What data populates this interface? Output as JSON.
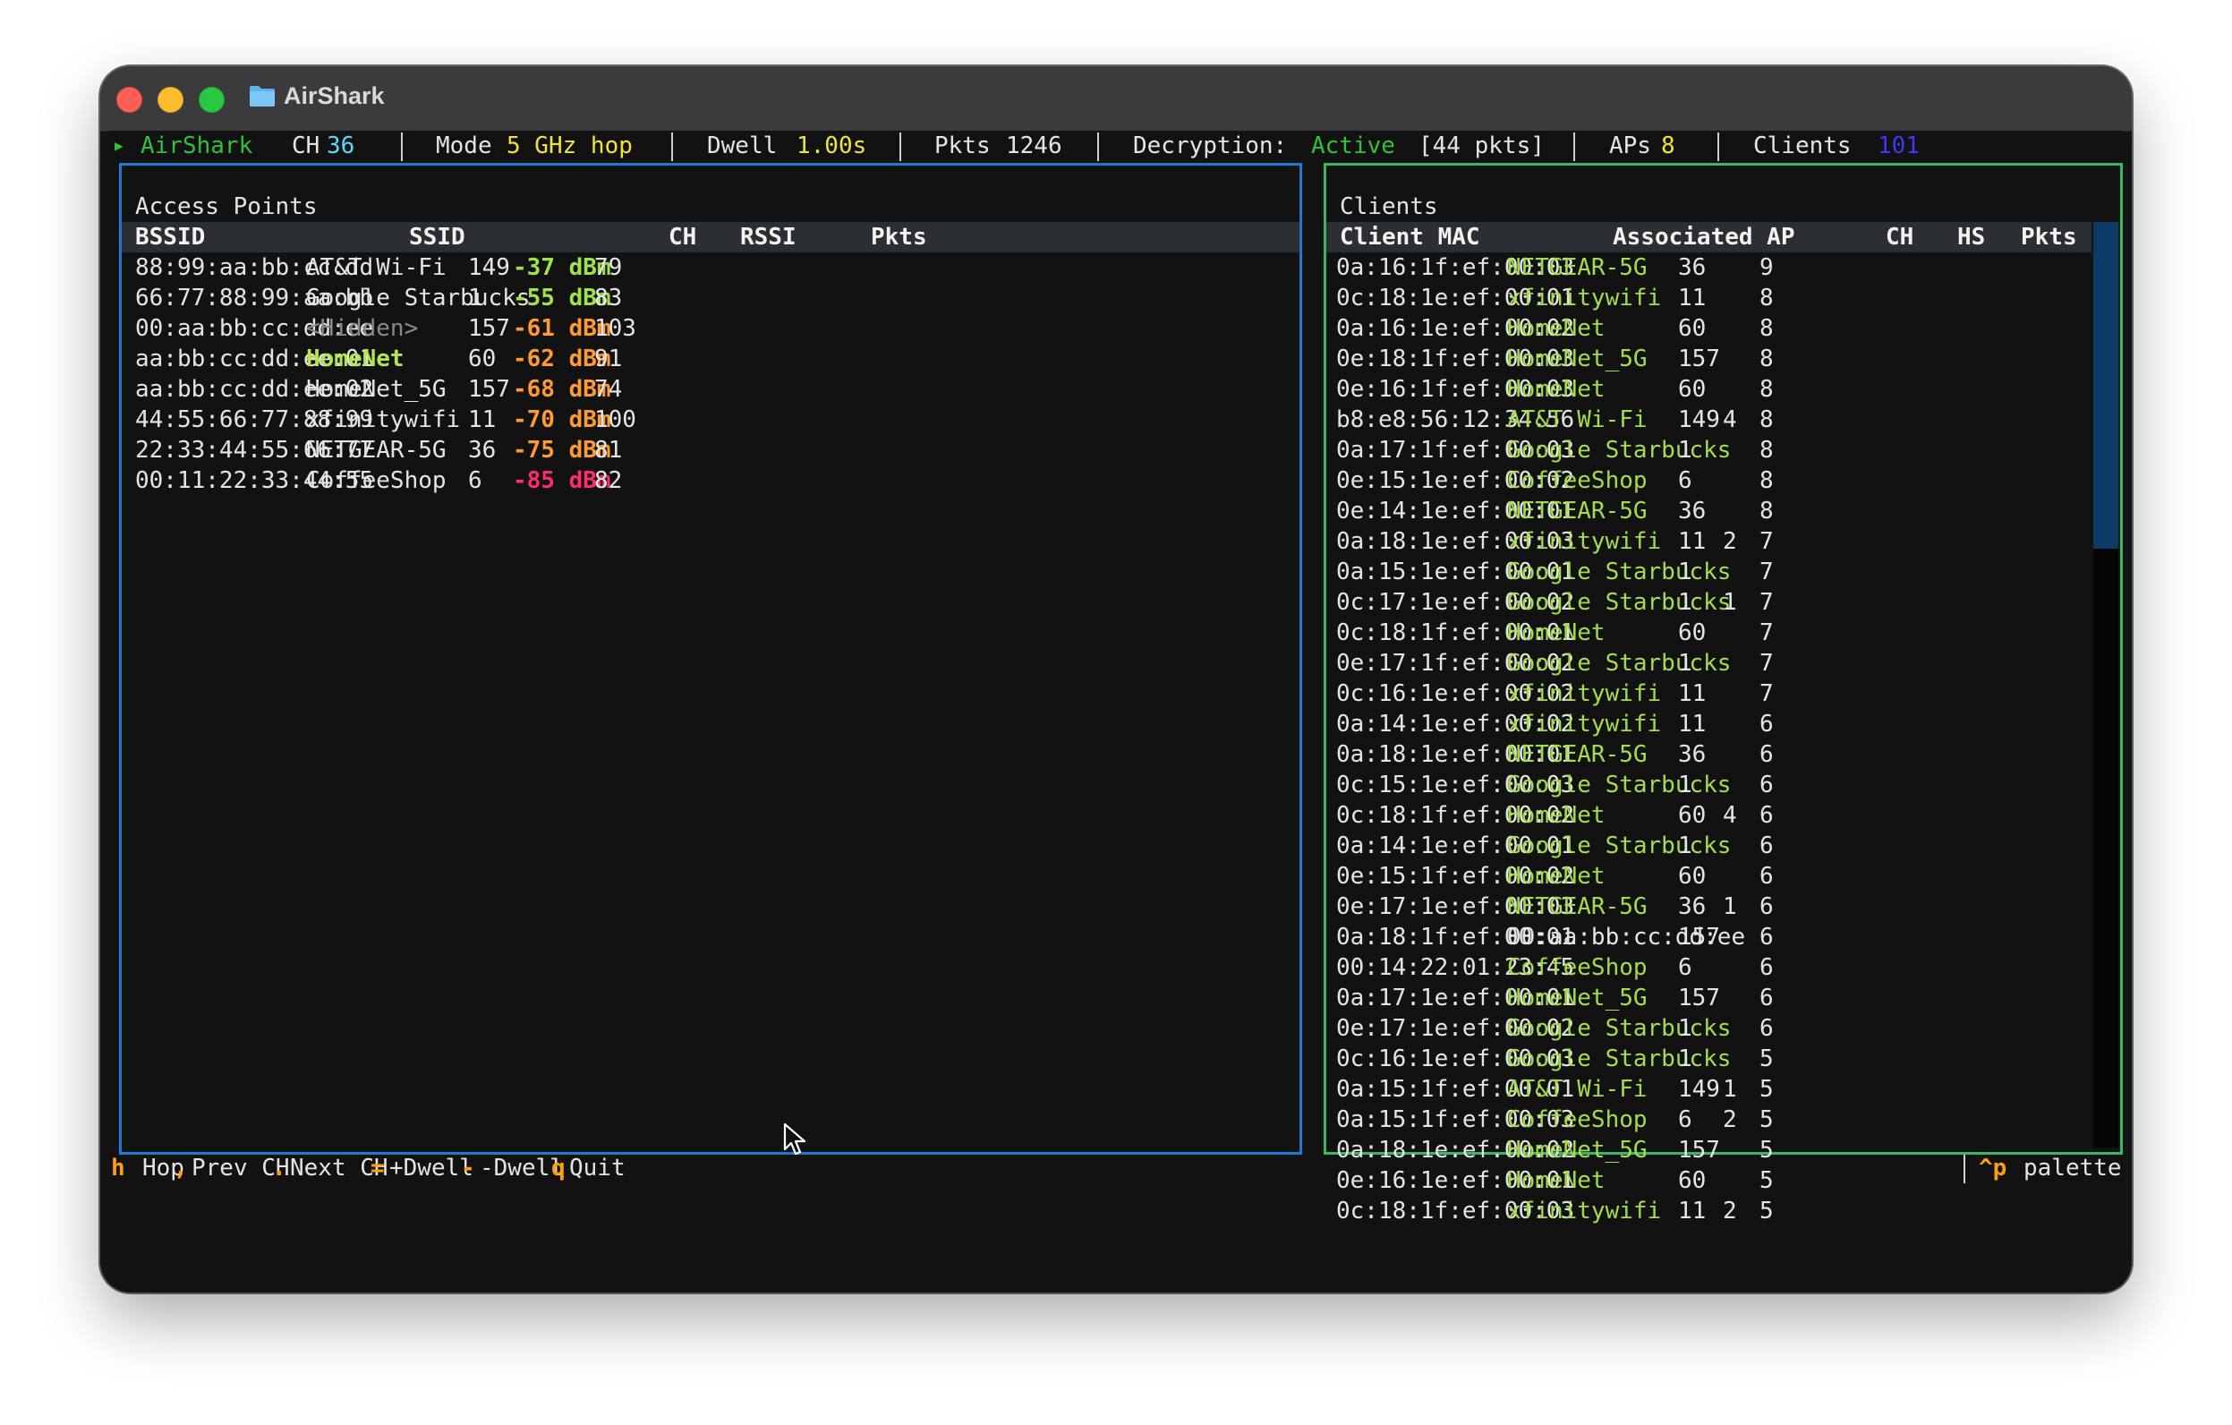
{
  "window": {
    "title": "AirShark",
    "icon": "folder-icon"
  },
  "statusbar": {
    "app_name": "AirShark",
    "ch_label": "CH",
    "ch_value": "36",
    "mode_label": "Mode",
    "mode_value": "5 GHz hop",
    "dwell_label": "Dwell",
    "dwell_value": "1.00s",
    "pkts_label": "Pkts",
    "pkts_value": "1246",
    "decryption_label": "Decryption:",
    "decryption_status": "Active",
    "decryption_detail": "[44 pkts]",
    "aps_label": "APs",
    "aps_value": "8",
    "clients_label": "Clients",
    "clients_value": "101"
  },
  "colors": {
    "ap_panel_border": "#1f78d6",
    "clients_panel_border": "#3bb764",
    "rssi_strong": "#9ee34a",
    "rssi_medium": "#ff9b2f",
    "rssi_weak": "#ff2b6a",
    "key_hint": "#ff9f0a"
  },
  "access_points": {
    "title": "Access Points",
    "columns": [
      "BSSID",
      "SSID",
      "CH",
      "RSSI",
      "Pkts"
    ],
    "rows": [
      {
        "bssid": "88:99:aa:bb:cc:dd",
        "ssid": "AT&T Wi-Fi",
        "ssid_style": "normal",
        "ch": "149",
        "rssi": "-37 dBm",
        "rssi_level": "strong",
        "pkts": "79"
      },
      {
        "bssid": "66:77:88:99:aa:bb",
        "ssid": "Google Starbucks",
        "ssid_style": "normal",
        "ch": "1",
        "rssi": "-55 dBm",
        "rssi_level": "strong",
        "pkts": "83"
      },
      {
        "bssid": "00:aa:bb:cc:dd:ee",
        "ssid": "<Hidden>",
        "ssid_style": "hidden",
        "ch": "157",
        "rssi": "-61 dBm",
        "rssi_level": "medium",
        "pkts": "103"
      },
      {
        "bssid": "aa:bb:cc:dd:ee:01",
        "ssid": "HomeNet",
        "ssid_style": "bold",
        "ch": "60",
        "rssi": "-62 dBm",
        "rssi_level": "medium",
        "pkts": "91"
      },
      {
        "bssid": "aa:bb:cc:dd:ee:02",
        "ssid": "HomeNet_5G",
        "ssid_style": "normal",
        "ch": "157",
        "rssi": "-68 dBm",
        "rssi_level": "medium",
        "pkts": "74"
      },
      {
        "bssid": "44:55:66:77:88:99",
        "ssid": "xfinitywifi",
        "ssid_style": "normal",
        "ch": "11",
        "rssi": "-70 dBm",
        "rssi_level": "medium",
        "pkts": "100"
      },
      {
        "bssid": "22:33:44:55:66:77",
        "ssid": "NETGEAR-5G",
        "ssid_style": "normal",
        "ch": "36",
        "rssi": "-75 dBm",
        "rssi_level": "medium",
        "pkts": "81"
      },
      {
        "bssid": "00:11:22:33:44:55",
        "ssid": "CoffeeShop",
        "ssid_style": "normal",
        "ch": "6",
        "rssi": "-85 dBm",
        "rssi_level": "weak",
        "pkts": "82"
      }
    ]
  },
  "clients": {
    "title": "Clients",
    "columns": [
      "Client MAC",
      "Associated AP",
      "CH",
      "HS",
      "Pkts"
    ],
    "scroll_fraction_visible": 0.31,
    "rows": [
      {
        "mac": "0a:16:1f:ef:00:03",
        "ap": "NETGEAR-5G",
        "ap_known": true,
        "ch": "36",
        "hs": "",
        "pkts": "9"
      },
      {
        "mac": "0c:18:1e:ef:00:01",
        "ap": "xfinitywifi",
        "ap_known": true,
        "ch": "11",
        "hs": "",
        "pkts": "8"
      },
      {
        "mac": "0a:16:1e:ef:00:02",
        "ap": "HomeNet",
        "ap_known": true,
        "ch": "60",
        "hs": "",
        "pkts": "8"
      },
      {
        "mac": "0e:18:1f:ef:00:03",
        "ap": "HomeNet_5G",
        "ap_known": true,
        "ch": "157",
        "hs": "",
        "pkts": "8"
      },
      {
        "mac": "0e:16:1f:ef:00:03",
        "ap": "HomeNet",
        "ap_known": true,
        "ch": "60",
        "hs": "",
        "pkts": "8"
      },
      {
        "mac": "b8:e8:56:12:34:56",
        "ap": "AT&T Wi-Fi",
        "ap_known": true,
        "ch": "149",
        "hs": "4",
        "pkts": "8"
      },
      {
        "mac": "0a:17:1f:ef:00:03",
        "ap": "Google Starbucks",
        "ap_known": true,
        "ch": "1",
        "hs": "",
        "pkts": "8"
      },
      {
        "mac": "0e:15:1e:ef:00:02",
        "ap": "CoffeeShop",
        "ap_known": true,
        "ch": "6",
        "hs": "",
        "pkts": "8"
      },
      {
        "mac": "0e:14:1e:ef:00:01",
        "ap": "NETGEAR-5G",
        "ap_known": true,
        "ch": "36",
        "hs": "",
        "pkts": "8"
      },
      {
        "mac": "0a:18:1e:ef:00:03",
        "ap": "xfinitywifi",
        "ap_known": true,
        "ch": "11",
        "hs": "2",
        "pkts": "7"
      },
      {
        "mac": "0a:15:1e:ef:00:01",
        "ap": "Google Starbucks",
        "ap_known": true,
        "ch": "1",
        "hs": "",
        "pkts": "7"
      },
      {
        "mac": "0c:17:1e:ef:00:02",
        "ap": "Google Starbucks",
        "ap_known": true,
        "ch": "1",
        "hs": "1",
        "pkts": "7"
      },
      {
        "mac": "0c:18:1f:ef:00:01",
        "ap": "HomeNet",
        "ap_known": true,
        "ch": "60",
        "hs": "",
        "pkts": "7"
      },
      {
        "mac": "0e:17:1f:ef:00:02",
        "ap": "Google Starbucks",
        "ap_known": true,
        "ch": "1",
        "hs": "",
        "pkts": "7"
      },
      {
        "mac": "0c:16:1e:ef:00:02",
        "ap": "xfinitywifi",
        "ap_known": true,
        "ch": "11",
        "hs": "",
        "pkts": "7"
      },
      {
        "mac": "0a:14:1e:ef:00:02",
        "ap": "xfinitywifi",
        "ap_known": true,
        "ch": "11",
        "hs": "",
        "pkts": "6"
      },
      {
        "mac": "0a:18:1e:ef:00:01",
        "ap": "NETGEAR-5G",
        "ap_known": true,
        "ch": "36",
        "hs": "",
        "pkts": "6"
      },
      {
        "mac": "0c:15:1e:ef:00:03",
        "ap": "Google Starbucks",
        "ap_known": true,
        "ch": "1",
        "hs": "",
        "pkts": "6"
      },
      {
        "mac": "0c:18:1f:ef:00:02",
        "ap": "HomeNet",
        "ap_known": true,
        "ch": "60",
        "hs": "4",
        "pkts": "6"
      },
      {
        "mac": "0a:14:1e:ef:00:01",
        "ap": "Google Starbucks",
        "ap_known": true,
        "ch": "1",
        "hs": "",
        "pkts": "6"
      },
      {
        "mac": "0e:15:1f:ef:00:02",
        "ap": "HomeNet",
        "ap_known": true,
        "ch": "60",
        "hs": "",
        "pkts": "6"
      },
      {
        "mac": "0e:17:1e:ef:00:03",
        "ap": "NETGEAR-5G",
        "ap_known": true,
        "ch": "36",
        "hs": "1",
        "pkts": "6"
      },
      {
        "mac": "0a:18:1f:ef:00:01",
        "ap": "00:aa:bb:cc:dd:ee",
        "ap_known": false,
        "ch": "157",
        "hs": "",
        "pkts": "6"
      },
      {
        "mac": "00:14:22:01:23:45",
        "ap": "CoffeeShop",
        "ap_known": true,
        "ch": "6",
        "hs": "",
        "pkts": "6"
      },
      {
        "mac": "0a:17:1e:ef:00:01",
        "ap": "HomeNet_5G",
        "ap_known": true,
        "ch": "157",
        "hs": "",
        "pkts": "6"
      },
      {
        "mac": "0e:17:1e:ef:00:02",
        "ap": "Google Starbucks",
        "ap_known": true,
        "ch": "1",
        "hs": "",
        "pkts": "6"
      },
      {
        "mac": "0c:16:1e:ef:00:03",
        "ap": "Google Starbucks",
        "ap_known": true,
        "ch": "1",
        "hs": "",
        "pkts": "5"
      },
      {
        "mac": "0a:15:1f:ef:00:01",
        "ap": "AT&T Wi-Fi",
        "ap_known": true,
        "ch": "149",
        "hs": "1",
        "pkts": "5"
      },
      {
        "mac": "0a:15:1f:ef:00:03",
        "ap": "CoffeeShop",
        "ap_known": true,
        "ch": "6",
        "hs": "2",
        "pkts": "5"
      },
      {
        "mac": "0a:18:1e:ef:00:02",
        "ap": "HomeNet_5G",
        "ap_known": true,
        "ch": "157",
        "hs": "",
        "pkts": "5"
      },
      {
        "mac": "0e:16:1e:ef:00:01",
        "ap": "HomeNet",
        "ap_known": true,
        "ch": "60",
        "hs": "",
        "pkts": "5"
      },
      {
        "mac": "0c:18:1f:ef:00:03",
        "ap": "xfinitywifi",
        "ap_known": true,
        "ch": "11",
        "hs": "2",
        "pkts": "5"
      }
    ]
  },
  "footer": {
    "bindings": [
      {
        "key": "h",
        "label": "Hop"
      },
      {
        "key": ",",
        "label": "Prev CH"
      },
      {
        "key": ".",
        "label": "Next CH"
      },
      {
        "key": "=",
        "label": "+Dwell"
      },
      {
        "key": "-",
        "label": "-Dwell"
      },
      {
        "key": "q",
        "label": "Quit"
      }
    ],
    "palette_key": "^p",
    "palette_label": "palette"
  }
}
